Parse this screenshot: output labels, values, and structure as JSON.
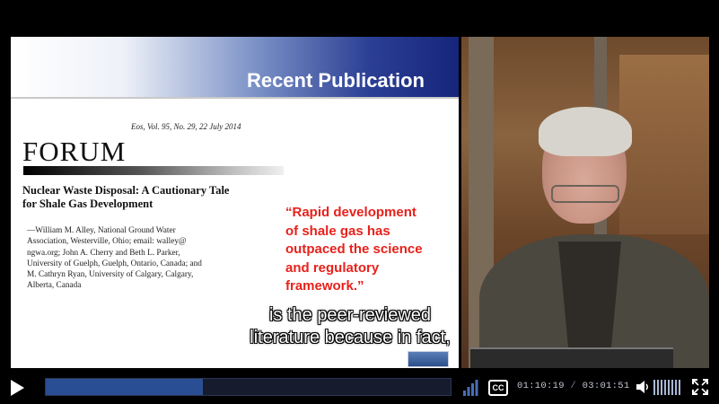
{
  "slide": {
    "title": "Recent Publication",
    "journal_line": "Eos, Vol. 95, No. 29, 22 July 2014",
    "section": "FORUM",
    "article_title_line1": "Nuclear Waste Disposal: A Cautionary Tale",
    "article_title_line2": "for Shale Gas Development",
    "authors_line1": "—William M. Alley, National Ground Water",
    "authors_line2": "Association, Westerville, Ohio; email: walley@",
    "authors_line3": "ngwa.org; John A. Cherry and Beth L. Parker,",
    "authors_line4": "University of Guelph, Guelph, Ontario, Canada; and",
    "authors_line5": "M. Cathryn Ryan, University of Calgary, Calgary,",
    "authors_line6": "Alberta, Canada",
    "quote_line1": "“Rapid development",
    "quote_line2": "of shale gas has",
    "quote_line3": "outpaced the science",
    "quote_line4": "and regulatory",
    "quote_line5": "framework.”"
  },
  "subtitles": {
    "line1": "is the peer-reviewed",
    "line2": "literature because in fact,"
  },
  "controls": {
    "cc_label": "CC",
    "current_time": "01:10:19",
    "separator": "/",
    "duration": "03:01:51",
    "progress": 0.387
  },
  "colors": {
    "quote": "#e8211b",
    "progress_fill": "#2a4e93",
    "progress_track": "#161c2e"
  },
  "icons": {
    "play": "play-icon",
    "quality": "signal-bars-icon",
    "captions": "cc-icon",
    "volume": "speaker-icon",
    "fullscreen": "fullscreen-icon"
  }
}
